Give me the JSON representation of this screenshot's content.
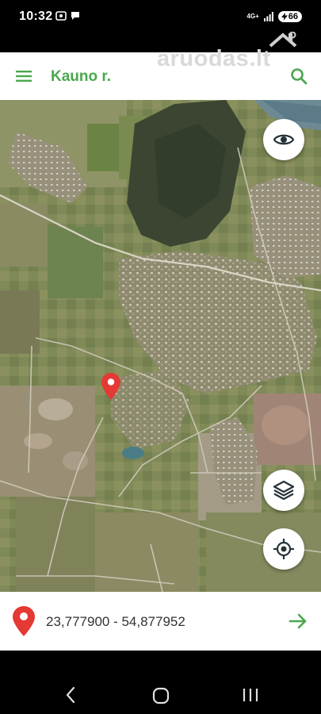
{
  "status_bar": {
    "time": "10:32",
    "network": "4G+",
    "battery": "66"
  },
  "app_bar": {
    "title": "Kauno r.",
    "watermark": "aruodas.lt"
  },
  "location": {
    "coordinates": "23,777900 - 54,877952"
  },
  "colors": {
    "accent": "#4aa84f",
    "pin": "#e53935"
  },
  "icons": {
    "menu": "hamburger-menu-icon",
    "search": "search-icon",
    "visibility": "eye-icon",
    "layers": "layers-icon",
    "my_location": "crosshair-location-icon",
    "pin": "map-pin-icon",
    "go": "arrow-right-icon",
    "back": "back-chevron-icon",
    "home": "home-circle-icon",
    "recent": "recent-apps-icon"
  }
}
